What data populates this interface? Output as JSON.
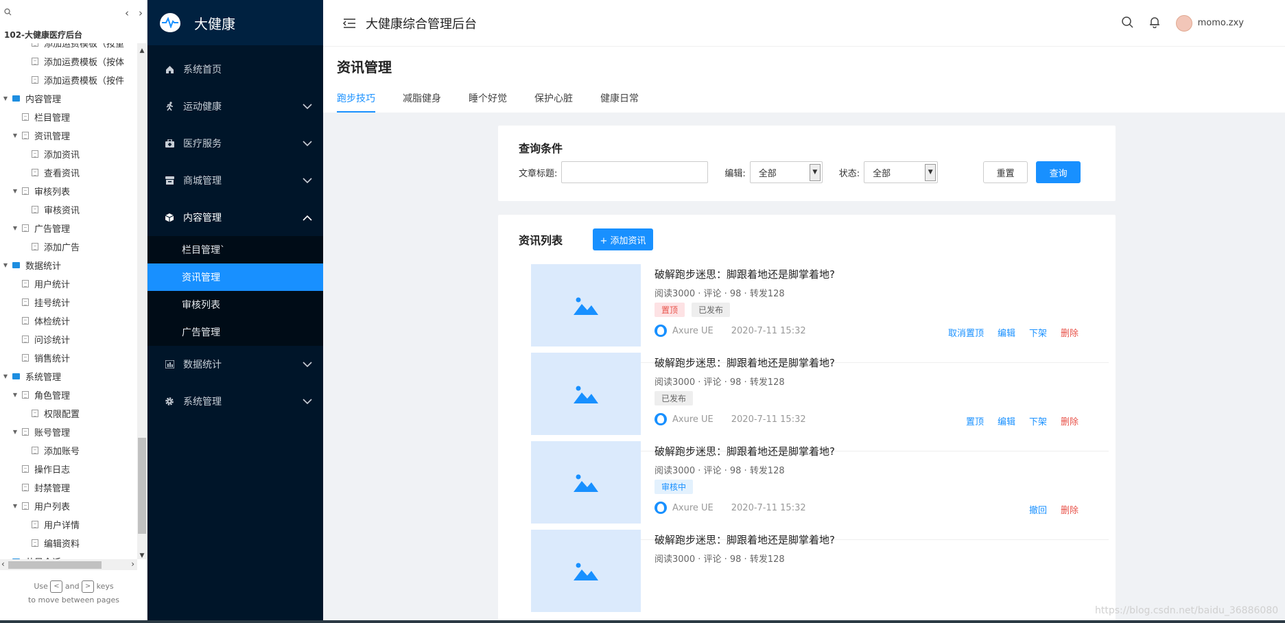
{
  "tree": {
    "project": "102-大健康医疗后台",
    "rows": [
      {
        "label": "添加运费模板（按重",
        "level": 3,
        "kind": "page",
        "toggle": ""
      },
      {
        "label": "添加运费模板（按体",
        "level": 3,
        "kind": "page",
        "toggle": ""
      },
      {
        "label": "添加运费模板（按件",
        "level": 3,
        "kind": "page",
        "toggle": ""
      },
      {
        "label": "内容管理",
        "level": 1,
        "kind": "folder",
        "toggle": "▼"
      },
      {
        "label": "栏目管理",
        "level": 2,
        "kind": "page",
        "toggle": ""
      },
      {
        "label": "资讯管理",
        "level": 2,
        "kind": "page",
        "toggle": "▼"
      },
      {
        "label": "添加资讯",
        "level": 3,
        "kind": "page",
        "toggle": ""
      },
      {
        "label": "查看资讯",
        "level": 3,
        "kind": "page",
        "toggle": ""
      },
      {
        "label": "审核列表",
        "level": 2,
        "kind": "page",
        "toggle": "▼"
      },
      {
        "label": "审核资讯",
        "level": 3,
        "kind": "page",
        "toggle": ""
      },
      {
        "label": "广告管理",
        "level": 2,
        "kind": "page",
        "toggle": "▼"
      },
      {
        "label": "添加广告",
        "level": 3,
        "kind": "page",
        "toggle": ""
      },
      {
        "label": "数据统计",
        "level": 1,
        "kind": "folder",
        "toggle": "▼"
      },
      {
        "label": "用户统计",
        "level": 2,
        "kind": "page",
        "toggle": ""
      },
      {
        "label": "挂号统计",
        "level": 2,
        "kind": "page",
        "toggle": ""
      },
      {
        "label": "体检统计",
        "level": 2,
        "kind": "page",
        "toggle": ""
      },
      {
        "label": "问诊统计",
        "level": 2,
        "kind": "page",
        "toggle": ""
      },
      {
        "label": "销售统计",
        "level": 2,
        "kind": "page",
        "toggle": ""
      },
      {
        "label": "系统管理",
        "level": 1,
        "kind": "folder",
        "toggle": "▼"
      },
      {
        "label": "角色管理",
        "level": 2,
        "kind": "page",
        "toggle": "▼"
      },
      {
        "label": "权限配置",
        "level": 3,
        "kind": "page",
        "toggle": ""
      },
      {
        "label": "账号管理",
        "level": 2,
        "kind": "page",
        "toggle": "▼"
      },
      {
        "label": "添加账号",
        "level": 3,
        "kind": "page",
        "toggle": ""
      },
      {
        "label": "操作日志",
        "level": 2,
        "kind": "page",
        "toggle": ""
      },
      {
        "label": "封禁管理",
        "level": 2,
        "kind": "page",
        "toggle": ""
      },
      {
        "label": "用户列表",
        "level": 2,
        "kind": "page",
        "toggle": "▼"
      },
      {
        "label": "用户详情",
        "level": 3,
        "kind": "page",
        "toggle": ""
      },
      {
        "label": "编辑资料",
        "level": 3,
        "kind": "page",
        "toggle": ""
      },
      {
        "label": "共目会话",
        "level": 1,
        "kind": "folder",
        "toggle": ""
      }
    ],
    "hint_use": "Use",
    "hint_and": "and",
    "hint_keys": "keys",
    "hint_line2": "to move between pages",
    "key_prev": "<",
    "key_next": ">"
  },
  "sidebar": {
    "brand": "大健康",
    "menu": [
      {
        "label": "系统首页",
        "icon": "home-icon",
        "caret": ""
      },
      {
        "label": "运动健康",
        "icon": "run-icon",
        "caret": "down"
      },
      {
        "label": "医疗服务",
        "icon": "medical-box-icon",
        "caret": "down"
      },
      {
        "label": "商城管理",
        "icon": "store-icon",
        "caret": "down"
      },
      {
        "label": "内容管理",
        "icon": "cube-icon",
        "caret": "up"
      }
    ],
    "submenu": [
      {
        "label": "栏目管理`",
        "active": false
      },
      {
        "label": "资讯管理",
        "active": true
      },
      {
        "label": "审核列表",
        "active": false
      },
      {
        "label": "广告管理",
        "active": false
      }
    ],
    "menu_after": [
      {
        "label": "数据统计",
        "icon": "bar-chart-icon",
        "caret": "down"
      },
      {
        "label": "系统管理",
        "icon": "gear-icon",
        "caret": "down"
      }
    ]
  },
  "topbar": {
    "title": "大健康综合管理后台",
    "user": "momo.zxy"
  },
  "page": {
    "title": "资讯管理",
    "tabs": [
      "跑步技巧",
      "减脂健身",
      "睡个好觉",
      "保护心脏",
      "健康日常"
    ],
    "active_tab": 0
  },
  "query": {
    "title": "查询条件",
    "article_title_label": "文章标题:",
    "article_title_value": "",
    "editor_label": "编辑:",
    "editor_value": "全部",
    "status_label": "状态:",
    "status_value": "全部",
    "reset_label": "重置",
    "search_label": "查询"
  },
  "list": {
    "title": "资讯列表",
    "add_label": "+ 添加资讯",
    "items": [
      {
        "title": "破解跑步迷思：脚跟着地还是脚掌着地?",
        "meta": "阅读3000 · 评论 · 98 · 转发128",
        "tags": [
          {
            "text": "置顶",
            "type": "top"
          },
          {
            "text": "已发布",
            "type": "pub"
          }
        ],
        "author": "Axure UE",
        "time": "2020-7-11 15:32",
        "actions": [
          {
            "text": "取消置顶",
            "danger": false
          },
          {
            "text": "编辑",
            "danger": false
          },
          {
            "text": "下架",
            "danger": false
          },
          {
            "text": "删除",
            "danger": true
          }
        ]
      },
      {
        "title": "破解跑步迷思：脚跟着地还是脚掌着地?",
        "meta": "阅读3000 · 评论 · 98 · 转发128",
        "tags": [
          {
            "text": "已发布",
            "type": "pub"
          }
        ],
        "author": "Axure UE",
        "time": "2020-7-11 15:32",
        "actions": [
          {
            "text": "置顶",
            "danger": false
          },
          {
            "text": "编辑",
            "danger": false
          },
          {
            "text": "下架",
            "danger": false
          },
          {
            "text": "删除",
            "danger": true
          }
        ]
      },
      {
        "title": "破解跑步迷思：脚跟着地还是脚掌着地?",
        "meta": "阅读3000 · 评论 · 98 · 转发128",
        "tags": [
          {
            "text": "审核中",
            "type": "review"
          }
        ],
        "author": "Axure UE",
        "time": "2020-7-11 15:32",
        "actions": [
          {
            "text": "撤回",
            "danger": false
          },
          {
            "text": "删除",
            "danger": true
          }
        ]
      },
      {
        "title": "破解跑步迷思：脚跟着地还是脚掌着地?",
        "meta": "阅读3000 · 评论 · 98 · 转发128",
        "tags": [],
        "author": "",
        "time": "",
        "actions": []
      }
    ]
  },
  "watermark": "https://blog.csdn.net/baidu_36886080",
  "colors": {
    "accent": "#1890ff",
    "sidebar": "#001529",
    "danger": "#e8534a"
  }
}
